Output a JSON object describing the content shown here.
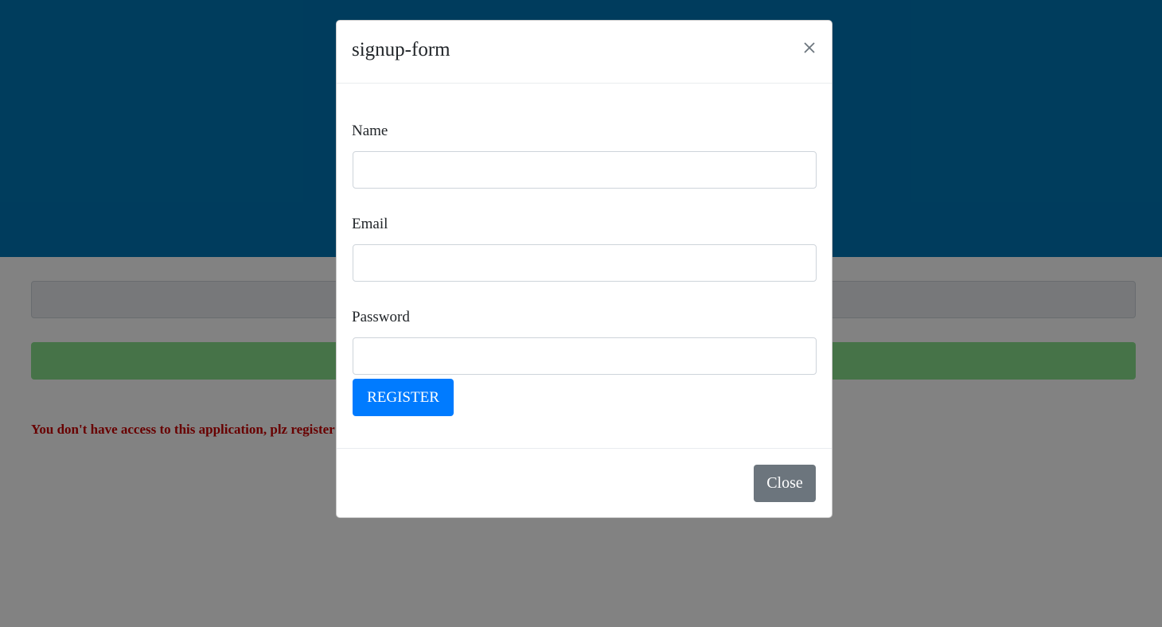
{
  "background": {
    "hero_color": "#0077b6",
    "access_message": "You don't have access to this application, plz register"
  },
  "modal": {
    "title": "signup-form",
    "close_icon": "close-icon",
    "fields": [
      {
        "label": "Name",
        "value": "",
        "placeholder": ""
      },
      {
        "label": "Email",
        "value": "",
        "placeholder": ""
      },
      {
        "label": "Password",
        "value": "",
        "placeholder": ""
      }
    ],
    "register_label": "REGISTER",
    "close_label": "Close"
  },
  "colors": {
    "primary": "#007bff",
    "secondary": "#6c757d",
    "error": "#cc0000"
  }
}
